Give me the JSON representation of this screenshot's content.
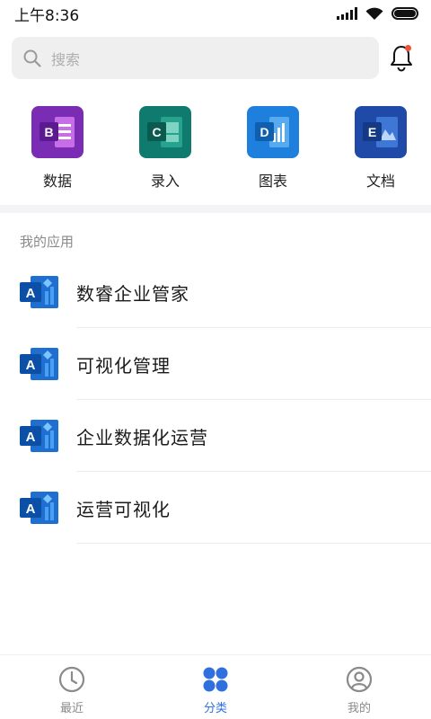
{
  "status_bar": {
    "time": "上午8:36"
  },
  "search": {
    "placeholder": "搜索"
  },
  "quick_apps": [
    {
      "letter": "B",
      "label": "数据",
      "color": "#7a2db4"
    },
    {
      "letter": "C",
      "label": "录入",
      "color": "#0f7b6e"
    },
    {
      "letter": "D",
      "label": "图表",
      "color": "#1e80dc"
    },
    {
      "letter": "E",
      "label": "文档",
      "color": "#1f4aa8"
    }
  ],
  "my_apps": {
    "title": "我的应用",
    "items": [
      {
        "letter": "A",
        "name": "数睿企业管家"
      },
      {
        "letter": "A",
        "name": "可视化管理"
      },
      {
        "letter": "A",
        "name": "企业数据化运营"
      },
      {
        "letter": "A",
        "name": "运营可视化"
      }
    ]
  },
  "bottom_nav": [
    {
      "label": "最近",
      "icon": "clock-icon",
      "active": false
    },
    {
      "label": "分类",
      "icon": "grid-icon",
      "active": true
    },
    {
      "label": "我的",
      "icon": "user-icon",
      "active": false
    }
  ],
  "colors": {
    "accent": "#2f6fe0",
    "notification_dot": "#f0513a",
    "app_icon_blue": "#1565c0"
  }
}
